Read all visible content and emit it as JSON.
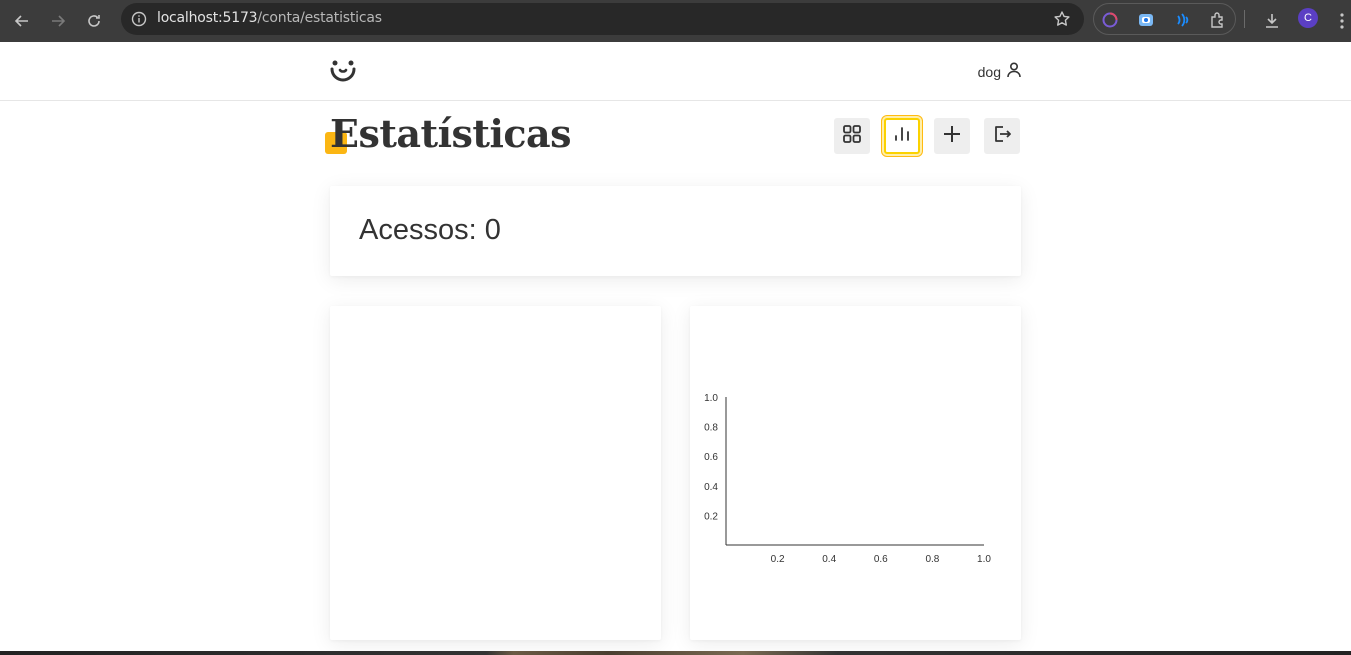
{
  "browser": {
    "url_host": "localhost:5173",
    "url_path": "/conta/estatisticas",
    "profile_initial": "C",
    "icons": [
      "back-icon",
      "forward-icon",
      "reload-icon",
      "site-info-icon",
      "bookmark-star-icon",
      "extension-icon",
      "download-icon",
      "menu-icon"
    ]
  },
  "header": {
    "username": "dog"
  },
  "page": {
    "title": "Estatísticas",
    "actions": [
      {
        "name": "feed",
        "icon": "grid-icon"
      },
      {
        "name": "estatisticas",
        "icon": "bar-chart-icon",
        "active": true
      },
      {
        "name": "postar",
        "icon": "plus-icon"
      },
      {
        "name": "sair",
        "icon": "logout-icon"
      }
    ]
  },
  "stats": {
    "total_label": "Acessos: 0"
  },
  "colors": {
    "accent": "#fbb613",
    "text": "#333333"
  },
  "chart_data": {
    "type": "bar",
    "categories": [],
    "values": [],
    "title": "",
    "xlabel": "",
    "ylabel": "",
    "xlim": [
      0,
      1.0
    ],
    "ylim": [
      0,
      1.0
    ],
    "x_ticks": [
      "0.2",
      "0.4",
      "0.6",
      "0.8",
      "1.0"
    ],
    "y_ticks": [
      "0.2",
      "0.4",
      "0.6",
      "0.8",
      "1.0"
    ],
    "grid": false
  }
}
